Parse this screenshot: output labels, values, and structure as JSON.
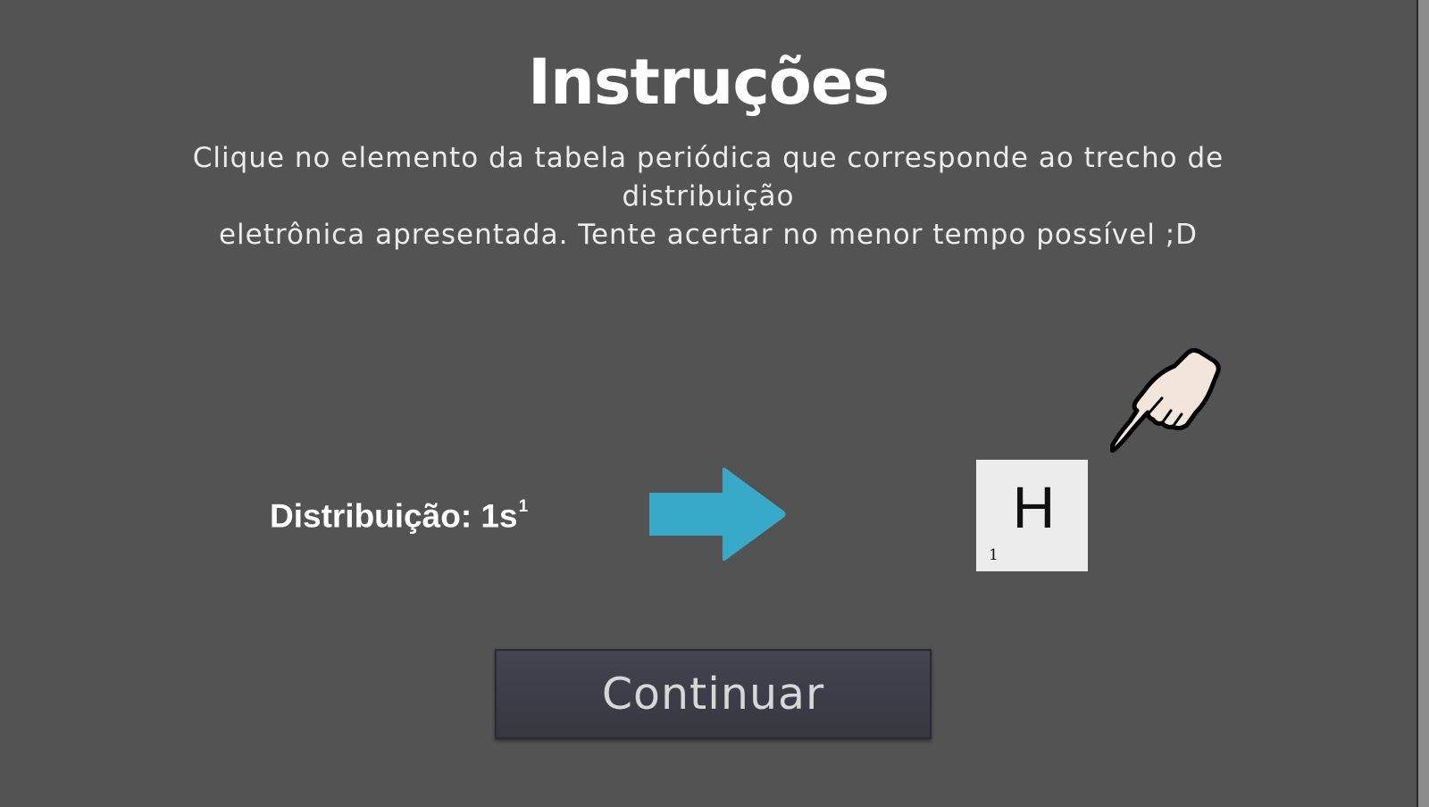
{
  "title": "Instruções",
  "instructions": {
    "line1": "Clique no elemento da tabela periódica que corresponde ao trecho de distribuição",
    "line2": "eletrônica apresentada. Tente acertar no menor tempo possível ;D"
  },
  "example": {
    "distribution_label": "Distribuição: 1s",
    "distribution_superscript": "1",
    "element": {
      "symbol": "H",
      "atomic_number": "1"
    }
  },
  "button": {
    "continue_label": "Continuar"
  },
  "icons": {
    "arrow": "arrow-right-icon",
    "hand": "pointing-hand-icon"
  },
  "colors": {
    "background": "#535353",
    "arrow": "#37aac9",
    "button_bg": "#3d3d48",
    "button_text": "#d7d7d7",
    "card": "#ececec",
    "hand": "#f2e6dc"
  }
}
